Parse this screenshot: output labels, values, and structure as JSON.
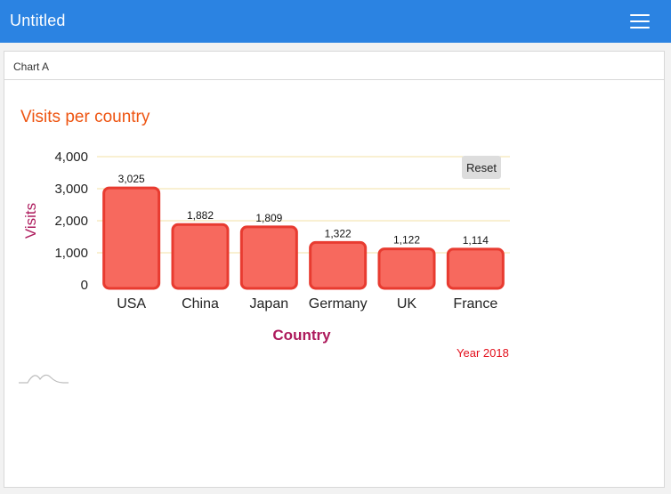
{
  "app": {
    "title": "Untitled",
    "menu_icon": "hamburger-menu-icon"
  },
  "panel": {
    "title": "Chart A"
  },
  "controls": {
    "reset_label": "Reset"
  },
  "note": "Year 2018",
  "colors": {
    "header": "#2b83e2",
    "title": "#ee5512",
    "axis_label": "#ad1a5c",
    "bar_fill": "#f7695e",
    "bar_stroke": "#e83b30",
    "grid": "#f3e2a6",
    "note": "#e3101c"
  },
  "chart_data": {
    "type": "bar",
    "title": "Visits per country",
    "xlabel": "Country",
    "ylabel": "Visits",
    "categories": [
      "USA",
      "China",
      "Japan",
      "Germany",
      "UK",
      "France"
    ],
    "values": [
      3025,
      1882,
      1809,
      1322,
      1122,
      1114
    ],
    "value_labels": [
      "3,025",
      "1,882",
      "1,809",
      "1,322",
      "1,122",
      "1,114"
    ],
    "ylim": [
      0,
      4000
    ],
    "yticks": [
      0,
      1000,
      2000,
      3000,
      4000
    ],
    "ytick_labels": [
      "0",
      "1,000",
      "2,000",
      "3,000",
      "4,000"
    ],
    "grid": true,
    "legend": false
  }
}
